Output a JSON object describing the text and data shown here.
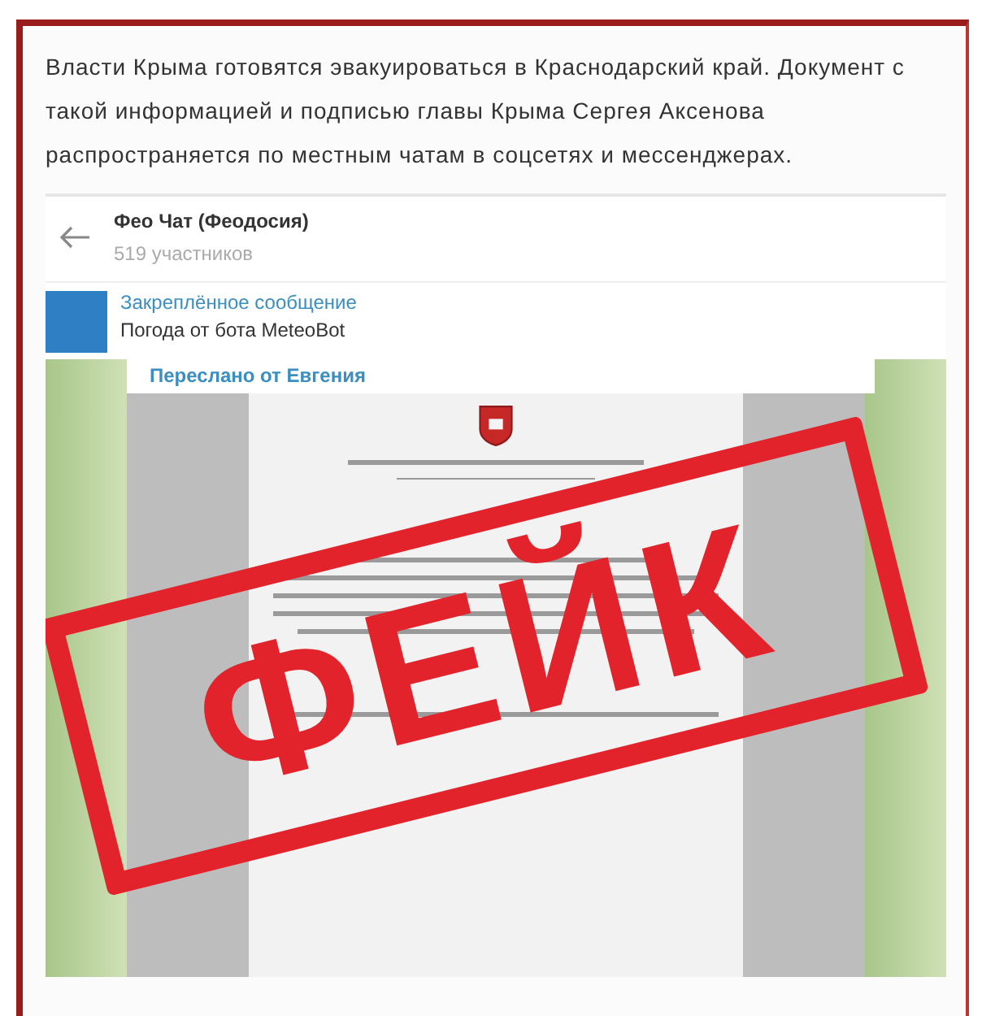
{
  "post": {
    "text": "Власти Крыма готовятся эвакуироваться в Краснодарский край. Документ с такой информацией и подписью главы Крыма Сергея Аксенова распространяется по местным чатам в соцсетях и мессенджерах."
  },
  "chat": {
    "title": "Фео Чат (Феодосия)",
    "subtitle": "519 участников",
    "pinned": {
      "label": "Закреплённое сообщение",
      "text": "Погода от бота MeteoBot"
    },
    "forwarded_from": "Переслано от Евгения"
  },
  "stamp": {
    "text": "ФЕЙК"
  }
}
